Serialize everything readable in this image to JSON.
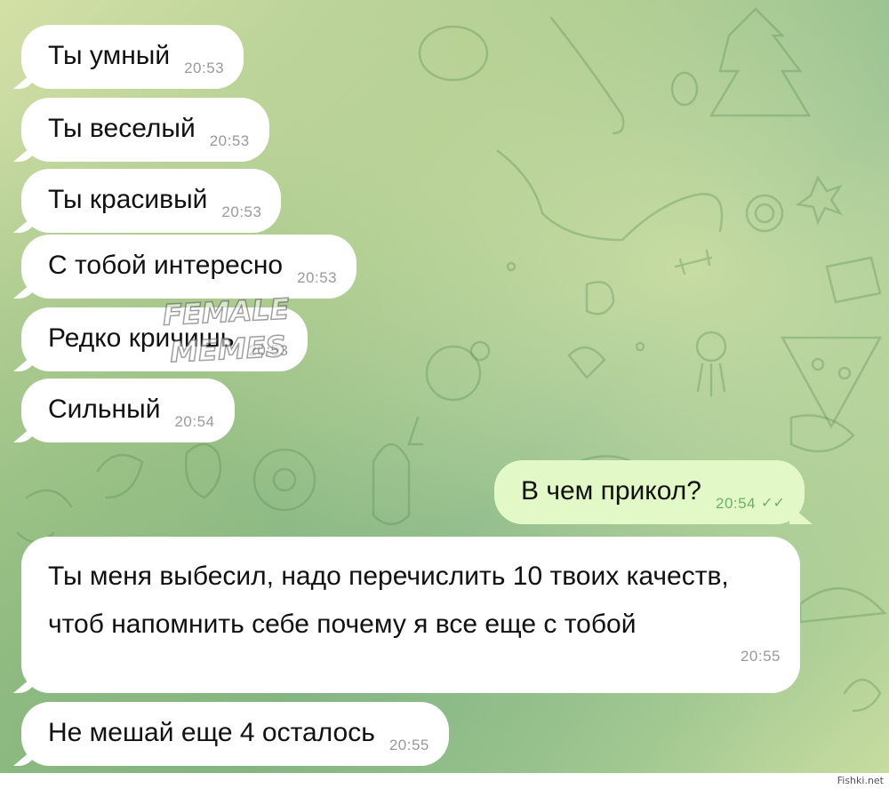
{
  "messages": [
    {
      "text": "Ты умный",
      "time": "20:53"
    },
    {
      "text": "Ты веселый",
      "time": "20:53"
    },
    {
      "text": "Ты красивый",
      "time": "20:53"
    },
    {
      "text": "С тобой интересно",
      "time": "20:53"
    },
    {
      "text": "Редко кричишь",
      "time": "20:53"
    },
    {
      "text": "Сильный",
      "time": "20:54"
    },
    {
      "text": "В чем прикол?",
      "time": "20:54",
      "outgoing": true,
      "status": "read"
    },
    {
      "text": "Ты меня выбесил, надо перечислить 10 твоих качеств, чтоб напомнить себе почему я все еще с тобой",
      "time": "20:55"
    },
    {
      "text": "Не мешай еще 4 осталось",
      "time": "20:55"
    }
  ],
  "watermark": {
    "line1": "FEMALE",
    "line2": "MEMES"
  },
  "source": "Fishki.net",
  "colors": {
    "incoming_bubble": "#ffffff",
    "outgoing_bubble": "#e3f8c7",
    "time_out": "#6db06a",
    "time_in": "#9a9a9a"
  }
}
